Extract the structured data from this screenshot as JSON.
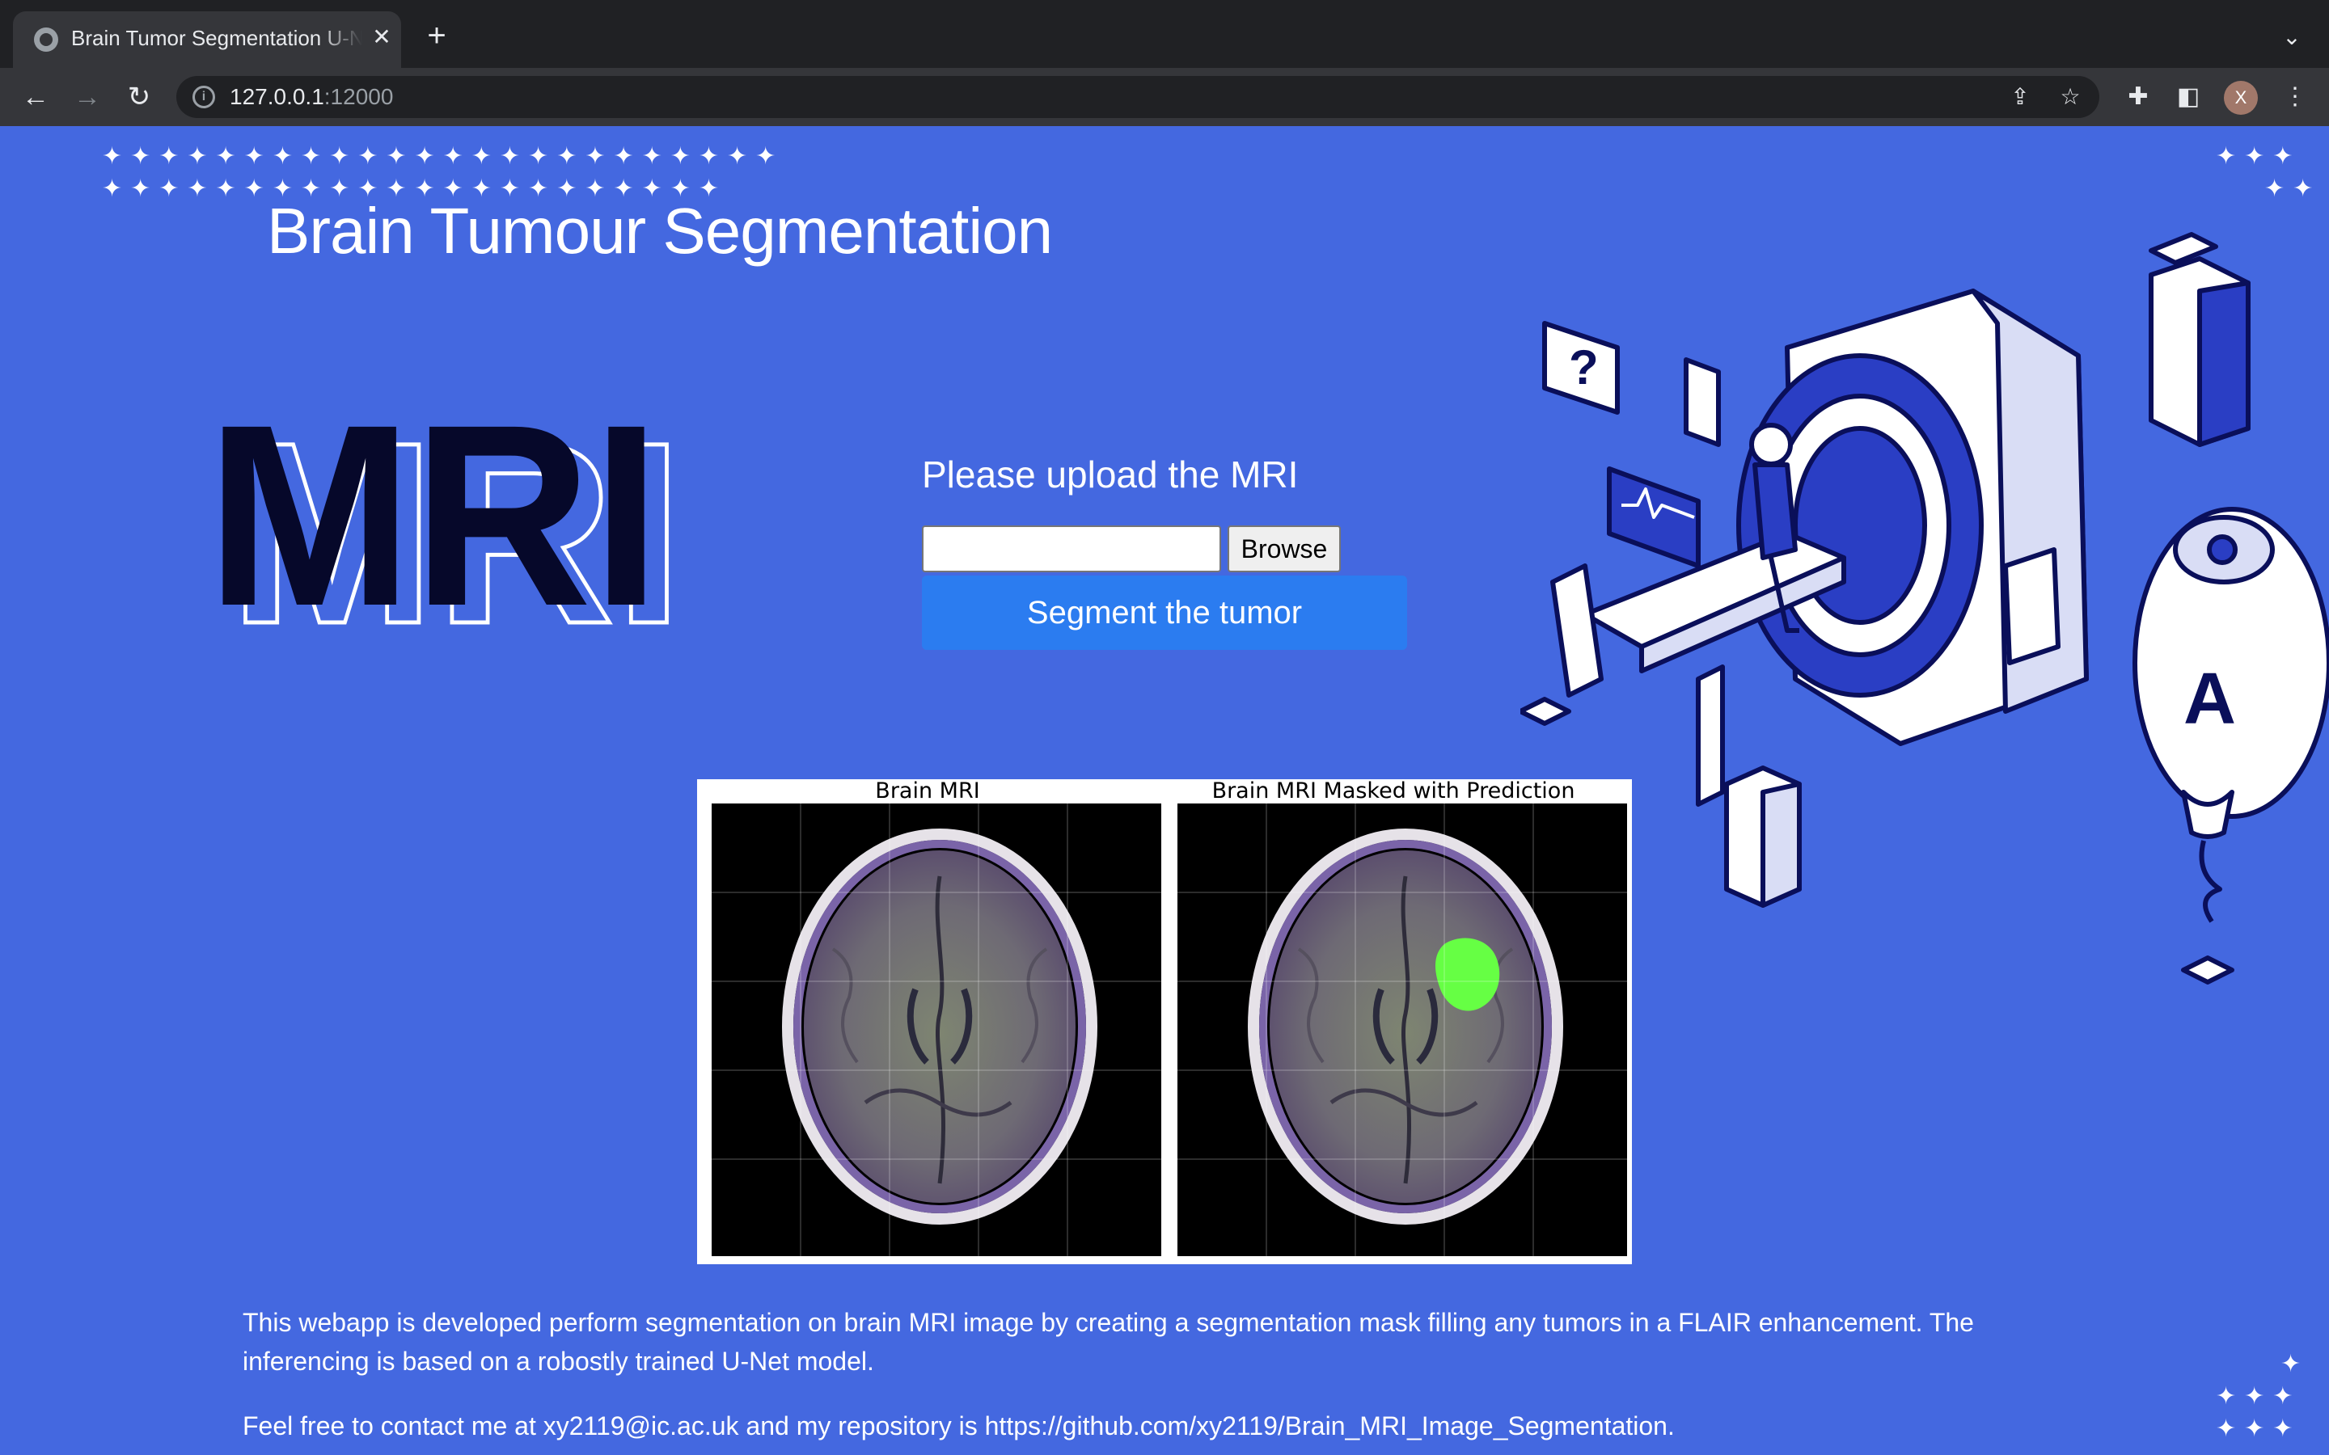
{
  "browser": {
    "tab_title": "Brain Tumor Segmentation U-Net",
    "tab_close_icon": "close-icon",
    "url_host": "127.0.0.1",
    "url_port": ":12000"
  },
  "page": {
    "title": "Brain Tumour Segmentation",
    "logo_text": "MRI",
    "upload_label": "Please upload the MRI",
    "browse_label": "Browse",
    "file_value": "",
    "segment_label": "Segment the tumor",
    "panel_left_title": "Brain MRI",
    "panel_right_title": "Brain MRI Masked with Prediction",
    "description": "This webapp is developed perform segmentation on brain MRI image by creating a segmentation mask filling any tumors in a FLAIR enhancement. The inferencing is based on a robostly trained U-Net model.",
    "contact": "Feel free to contact me at xy2119@ic.ac.uk and my repository is https://github.com/xy2119/Brain_MRI_Image_Segmentation."
  },
  "colors": {
    "page_bg": "#4468e0",
    "primary_button": "#2b7cf0",
    "mask": "#66ff44",
    "logo_dark": "#06082a"
  }
}
